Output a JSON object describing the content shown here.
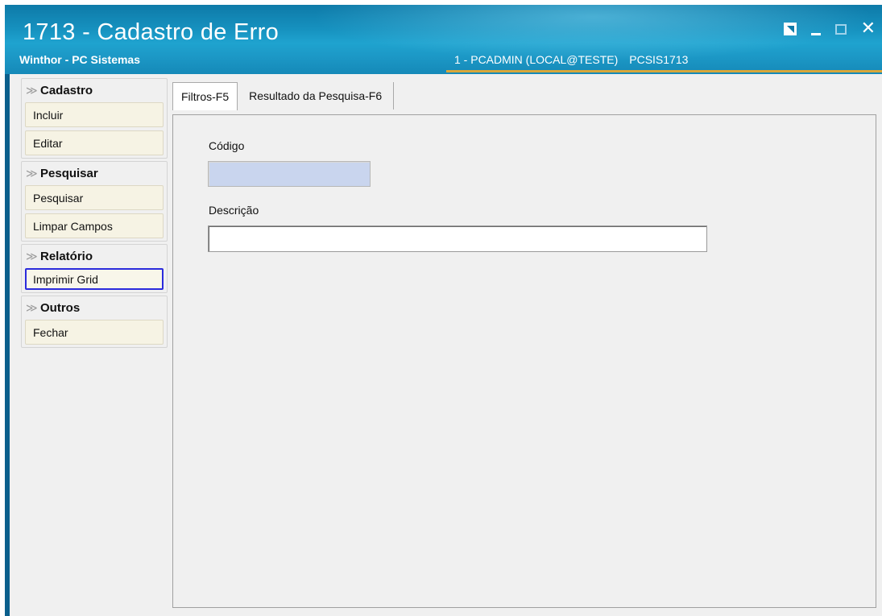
{
  "window": {
    "title": "1713 - Cadastro de Erro",
    "subtitle": "Winthor - PC Sistemas",
    "user_info": "1 - PCADMIN (LOCAL@TESTE)",
    "routine_code": "PCSIS1713",
    "controls": {
      "restore_icon": "restore-icon",
      "minimize_icon": "minimize-icon",
      "maximize_icon": "maximize-icon",
      "close_label": "✕"
    }
  },
  "sidebar": {
    "groups": [
      {
        "title": "Cadastro",
        "items": [
          "Incluir",
          "Editar"
        ]
      },
      {
        "title": "Pesquisar",
        "items": [
          "Pesquisar",
          "Limpar Campos"
        ]
      },
      {
        "title": "Relatório",
        "items": [
          "Imprimir Grid"
        ]
      },
      {
        "title": "Outros",
        "items": [
          "Fechar"
        ]
      }
    ],
    "chevron": "«"
  },
  "tabs": [
    {
      "label": "Filtros-F5",
      "active": true
    },
    {
      "label": "Resultado da Pesquisa-F6",
      "active": false
    }
  ],
  "filters": {
    "codigo_label": "Código",
    "codigo_value": "",
    "descricao_label": "Descrição",
    "descricao_value": ""
  },
  "colors": {
    "title_bar": "#1691bf",
    "accent_line": "#d9a73a",
    "codigo_field_bg": "#c9d5ee",
    "focus_border": "#2b2bdc"
  }
}
